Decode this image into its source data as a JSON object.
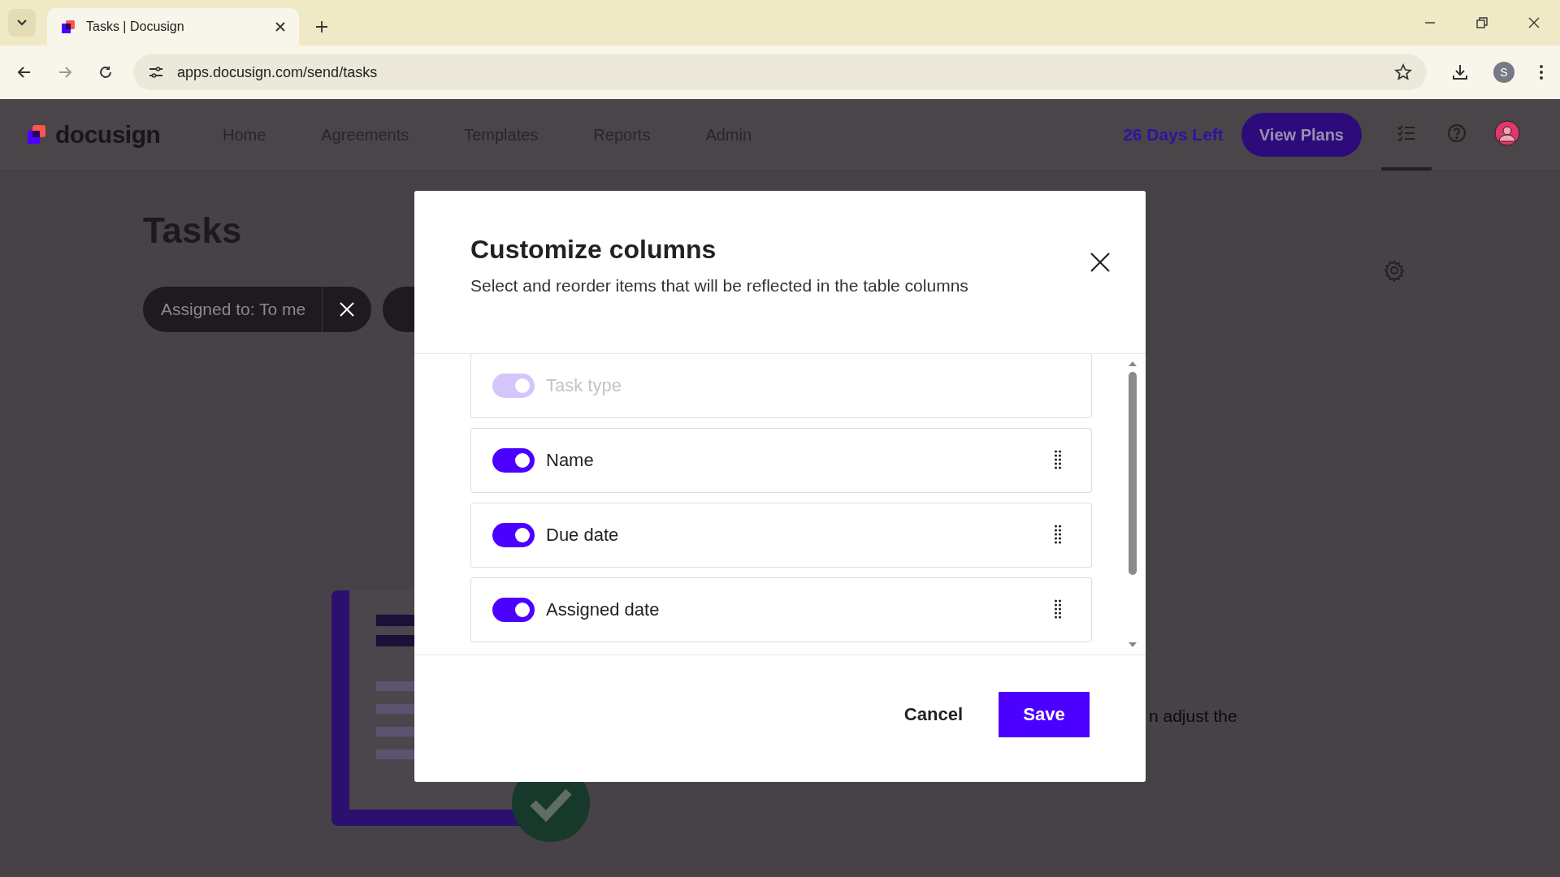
{
  "browser": {
    "tab_title": "Tasks | Docusign",
    "url": "apps.docusign.com/send/tasks",
    "profile_initial": "S"
  },
  "header": {
    "logo": "docusign",
    "nav": [
      {
        "label": "Home"
      },
      {
        "label": "Agreements"
      },
      {
        "label": "Templates"
      },
      {
        "label": "Reports"
      },
      {
        "label": "Admin"
      }
    ],
    "trial": "26 Days Left",
    "plans_button": "View Plans",
    "icons": [
      {
        "kind": "tasks",
        "selected": true
      },
      {
        "kind": "help",
        "selected": false
      },
      {
        "kind": "avatar",
        "selected": false
      }
    ]
  },
  "page": {
    "title": "Tasks",
    "filter_chip": "Assigned to: To me",
    "empty_text": "n adjust the"
  },
  "modal": {
    "title": "Customize columns",
    "description": "Select and reorder items that will be reflected in the table columns",
    "columns": [
      {
        "label": "Task type",
        "on": true,
        "disabled": true
      },
      {
        "label": "Name",
        "on": true,
        "disabled": false
      },
      {
        "label": "Due date",
        "on": true,
        "disabled": false
      },
      {
        "label": "Assigned date",
        "on": true,
        "disabled": false
      }
    ],
    "cancel": "Cancel",
    "save": "Save"
  }
}
